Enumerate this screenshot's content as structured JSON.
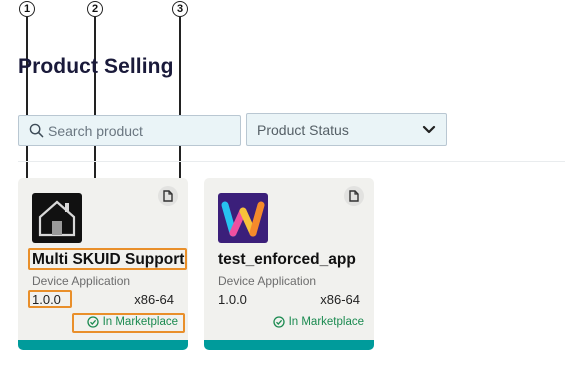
{
  "callouts": [
    "1",
    "2",
    "3"
  ],
  "page": {
    "title": "Product Selling"
  },
  "search": {
    "placeholder": "Search product"
  },
  "filter": {
    "status_label": "Product Status"
  },
  "colors": {
    "accent_teal": "#009b9b",
    "highlight_orange": "#e98f2a",
    "status_green": "#1b8a50",
    "card_bg": "#f1f1ee"
  },
  "cards": [
    {
      "name": "Multi SKUID Support",
      "type": "Device Application",
      "version": "1.0.0",
      "arch": "x86-64",
      "status": "In Marketplace",
      "icon": "house-icon"
    },
    {
      "name": "test_enforced_app",
      "type": "Device Application",
      "version": "1.0.0",
      "arch": "x86-64",
      "status": "In Marketplace",
      "icon": "w-logo-icon"
    }
  ]
}
